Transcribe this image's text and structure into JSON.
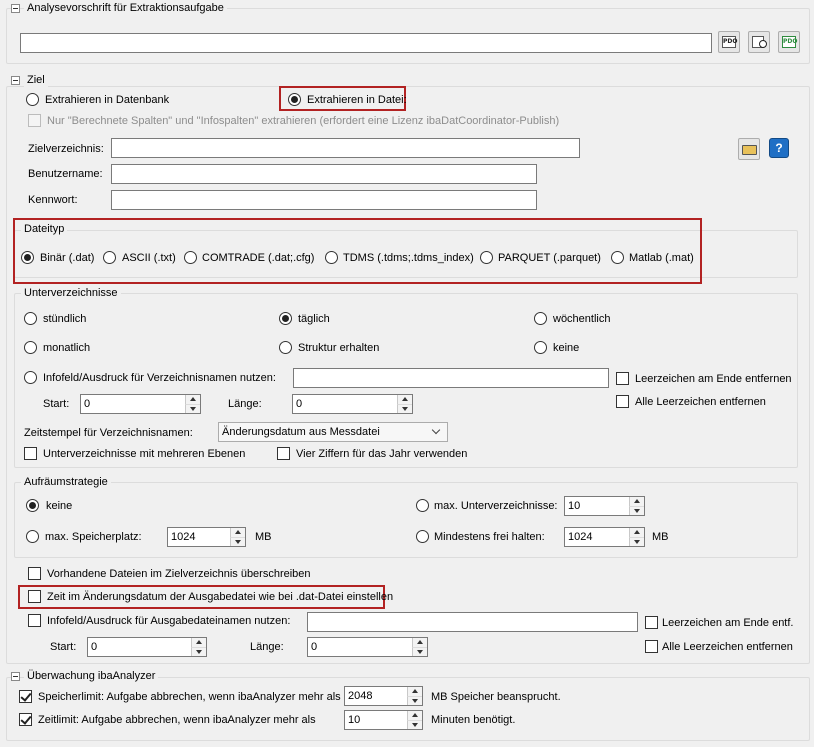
{
  "analysis": {
    "title": "Analysevorschrift für Extraktionsaufgabe",
    "path_value": "",
    "pdo_icon_text": "PDO"
  },
  "target": {
    "title": "Ziel",
    "extract_db_label": "Extrahieren in Datenbank",
    "extract_file_label": "Extrahieren in Datei:",
    "computed_only_label": "Nur \"Berechnete Spalten\" und \"Infospalten\" extrahieren (erfordert eine Lizenz ibaDatCoordinator-Publish)",
    "target_dir_label": "Zielverzeichnis:",
    "target_dir_value": "",
    "username_label": "Benutzername:",
    "username_value": "",
    "password_label": "Kennwort:",
    "password_value": "",
    "help_glyph": "?"
  },
  "filetype": {
    "title": "Dateityp",
    "options": [
      "Binär (.dat)",
      "ASCII (.txt)",
      "COMTRADE (.dat;.cfg)",
      "TDMS (.tdms;.tdms_index)",
      "PARQUET (.parquet)",
      "Matlab (.mat)"
    ],
    "selected": "Binär (.dat)"
  },
  "subdirs": {
    "title": "Unterverzeichnisse",
    "hourly": "stündlich",
    "daily": "täglich",
    "weekly": "wöchentlich",
    "monthly": "monatlich",
    "keep_structure": "Struktur erhalten",
    "none": "keine",
    "selected": "täglich",
    "infofield_label": "Infofeld/Ausdruck für Verzeichnisnamen nutzen:",
    "infofield_value": "",
    "trim_end_label": "Leerzeichen am Ende entfernen",
    "trim_all_label": "Alle Leerzeichen entfernen",
    "start_label": "Start:",
    "start_value": "0",
    "length_label": "Länge:",
    "length_value": "0",
    "timestamp_label": "Zeitstempel für Verzeichnisnamen:",
    "timestamp_value": "Änderungsdatum aus Messdatei",
    "multilevel_label": "Unterverzeichnisse mit mehreren Ebenen",
    "four_digit_label": "Vier Ziffern für das Jahr verwenden"
  },
  "cleanup": {
    "title": "Aufräumstrategie",
    "none_label": "keine",
    "max_subdirs_label": "max. Unterverzeichnisse:",
    "max_subdirs_value": "10",
    "max_storage_label": "max. Speicherplatz:",
    "max_storage_value": "1024",
    "max_storage_unit": "MB",
    "min_free_label": "Mindestens frei halten:",
    "min_free_value": "1024",
    "min_free_unit": "MB",
    "selected": "keine"
  },
  "output": {
    "overwrite_label": "Vorhandene Dateien im Zielverzeichnis überschreiben",
    "set_time_label": "Zeit im Änderungsdatum der Ausgabedatei wie bei .dat-Datei einstellen",
    "infofield_label": "Infofeld/Ausdruck für Ausgabedateinamen nutzen:",
    "infofield_value": "",
    "trim_end_label": "Leerzeichen am Ende entf.",
    "trim_all_label": "Alle Leerzeichen entfernen",
    "start_label": "Start:",
    "start_value": "0",
    "length_label": "Länge:",
    "length_value": "0"
  },
  "monitor": {
    "title": "Überwachung ibaAnalyzer",
    "memory_label": "Speicherlimit: Aufgabe abbrechen, wenn ibaAnalyzer mehr als",
    "memory_value": "2048",
    "memory_suffix": "MB Speicher beansprucht.",
    "time_label": "Zeitlimit: Aufgabe abbrechen, wenn ibaAnalyzer mehr als",
    "time_value": "10",
    "time_suffix": "Minuten benötigt."
  },
  "colors": {
    "highlight": "#b22222",
    "help_blue": "#1f6fc5",
    "folder_yellow": "#e8c15a"
  }
}
